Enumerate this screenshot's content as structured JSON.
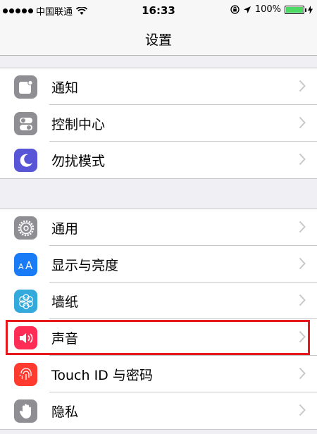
{
  "status": {
    "carrier": "中国联通",
    "time": "16:33",
    "battery": "100%"
  },
  "nav": {
    "title": "设置"
  },
  "group1": [
    {
      "label": "通知",
      "icon": "notifications-icon",
      "color": "#8e8e93"
    },
    {
      "label": "控制中心",
      "icon": "control-center-icon",
      "color": "#8e8e93"
    },
    {
      "label": "勿扰模式",
      "icon": "moon-icon",
      "color": "#5856d6"
    }
  ],
  "group2": [
    {
      "label": "通用",
      "icon": "gear-icon",
      "color": "#8e8e93"
    },
    {
      "label": "显示与亮度",
      "icon": "display-icon",
      "color": "#1a7bf7"
    },
    {
      "label": "墙纸",
      "icon": "wallpaper-icon",
      "color": "#34aadc"
    },
    {
      "label": "声音",
      "icon": "speaker-icon",
      "color": "#ff2d55"
    },
    {
      "label": "Touch ID 与密码",
      "icon": "fingerprint-icon",
      "color": "#ff3b30"
    },
    {
      "label": "隐私",
      "icon": "hand-icon",
      "color": "#8e8e93"
    }
  ],
  "highlight_color": "#e5191c"
}
